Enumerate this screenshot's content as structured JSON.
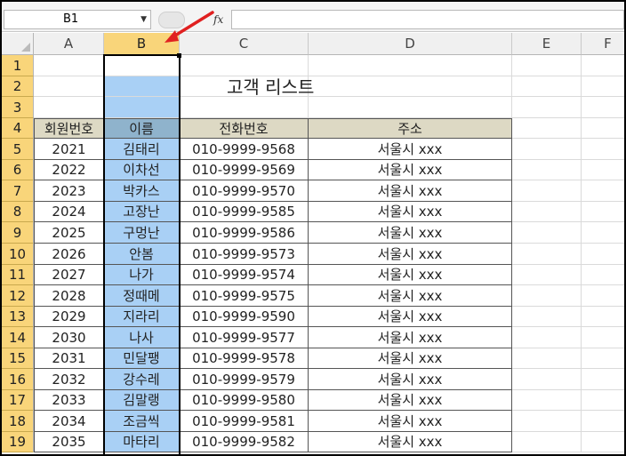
{
  "formula_bar": {
    "name_box": "B1",
    "fx_label": "fx",
    "formula": ""
  },
  "columns": [
    "A",
    "B",
    "C",
    "D",
    "E",
    "F"
  ],
  "selected_column": "B",
  "title": "고객 리스트",
  "table_headers": [
    "회원번호",
    "이름",
    "전화번호",
    "주소"
  ],
  "rows": [
    {
      "id": "2021",
      "name": "김태리",
      "phone": "010-9999-9568",
      "addr": "서울시 xxx"
    },
    {
      "id": "2022",
      "name": "이차선",
      "phone": "010-9999-9569",
      "addr": "서울시 xxx"
    },
    {
      "id": "2023",
      "name": "박카스",
      "phone": "010-9999-9570",
      "addr": "서울시 xxx"
    },
    {
      "id": "2024",
      "name": "고장난",
      "phone": "010-9999-9585",
      "addr": "서울시 xxx"
    },
    {
      "id": "2025",
      "name": "구멍난",
      "phone": "010-9999-9586",
      "addr": "서울시 xxx"
    },
    {
      "id": "2026",
      "name": "안봄",
      "phone": "010-9999-9573",
      "addr": "서울시 xxx"
    },
    {
      "id": "2027",
      "name": "나가",
      "phone": "010-9999-9574",
      "addr": "서울시 xxx"
    },
    {
      "id": "2028",
      "name": "정때메",
      "phone": "010-9999-9575",
      "addr": "서울시 xxx"
    },
    {
      "id": "2029",
      "name": "지라리",
      "phone": "010-9999-9590",
      "addr": "서울시 xxx"
    },
    {
      "id": "2030",
      "name": "나사",
      "phone": "010-9999-9577",
      "addr": "서울시 xxx"
    },
    {
      "id": "2031",
      "name": "민달팽",
      "phone": "010-9999-9578",
      "addr": "서울시 xxx"
    },
    {
      "id": "2032",
      "name": "강수레",
      "phone": "010-9999-9579",
      "addr": "서울시 xxx"
    },
    {
      "id": "2033",
      "name": "김말랭",
      "phone": "010-9999-9580",
      "addr": "서울시 xxx"
    },
    {
      "id": "2034",
      "name": "조금씩",
      "phone": "010-9999-9581",
      "addr": "서울시 xxx"
    },
    {
      "id": "2035",
      "name": "마타리",
      "phone": "010-9999-9582",
      "addr": "서울시 xxx"
    }
  ],
  "row_numbers": [
    "1",
    "2",
    "3",
    "4",
    "5",
    "6",
    "7",
    "8",
    "9",
    "10",
    "11",
    "12",
    "13",
    "14",
    "15",
    "16",
    "17",
    "18",
    "19"
  ],
  "colors": {
    "selection": "#a9d0f5",
    "header_fill": "#ddd9c4",
    "arrow": "#e02020"
  },
  "icons": {
    "name_box_dropdown": "chevron-down-icon",
    "fx": "function-icon",
    "annotation": "red-arrow-icon"
  }
}
